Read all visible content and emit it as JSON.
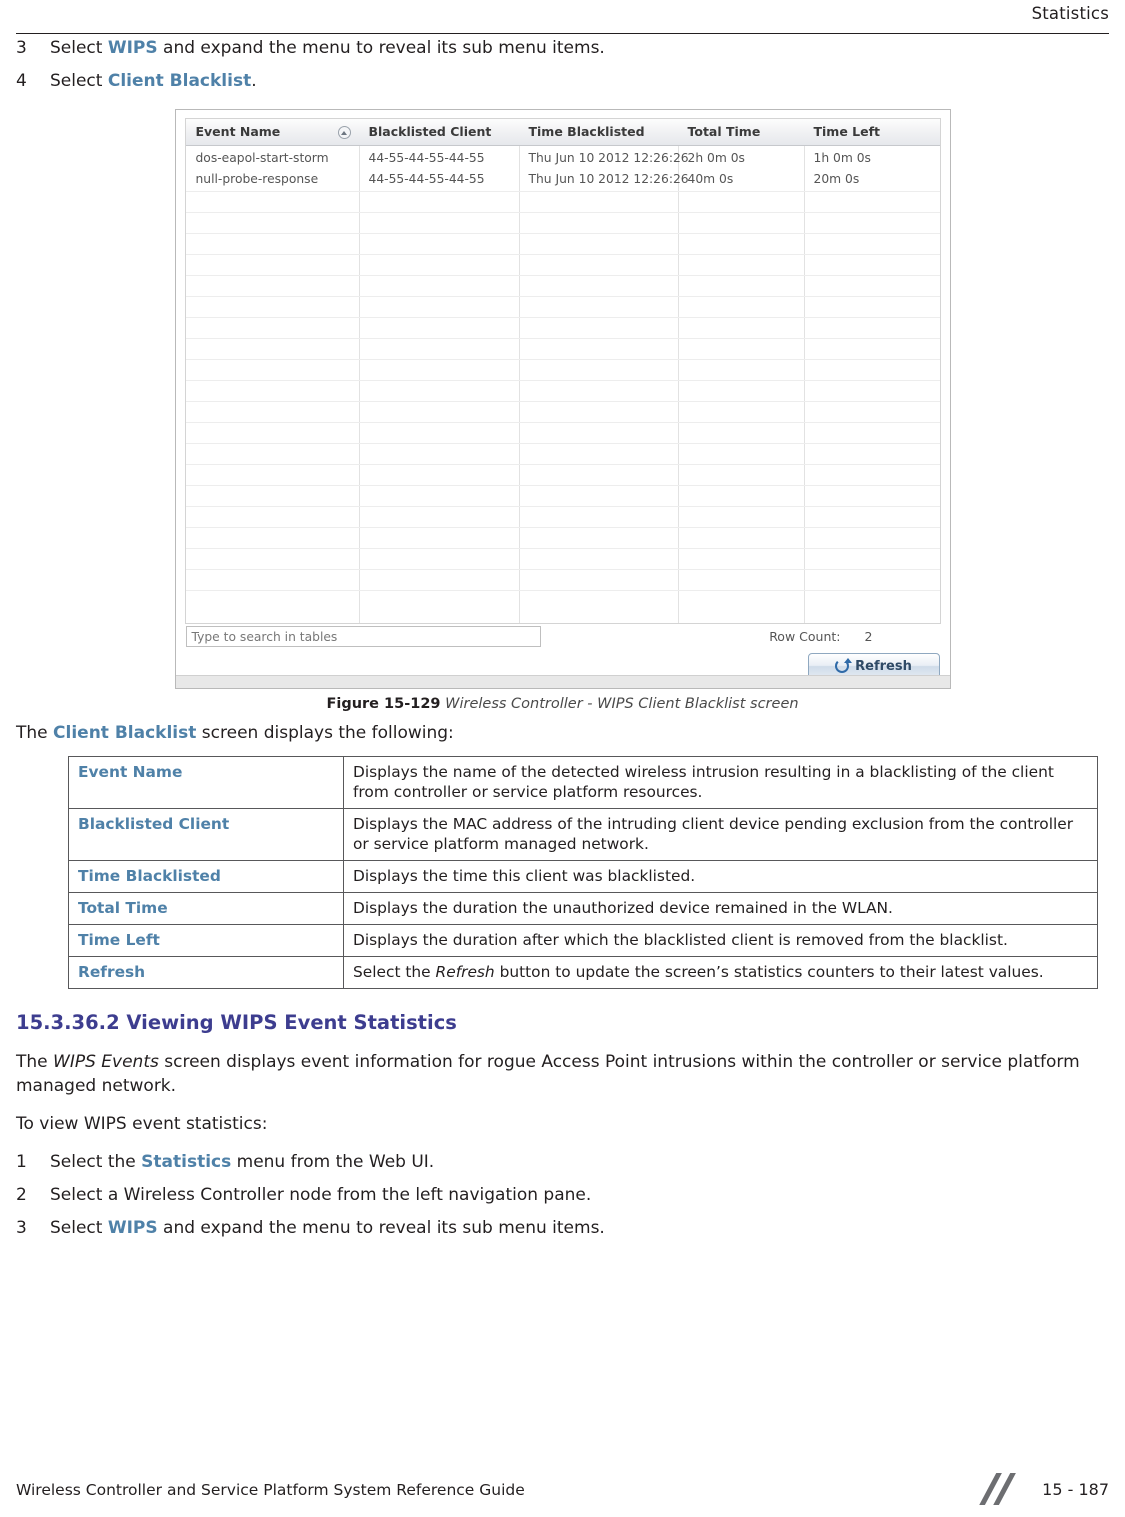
{
  "header": {
    "title": "Statistics"
  },
  "steps_top": [
    {
      "num": "3",
      "pre": "Select ",
      "link": "WIPS",
      "post": " and expand the menu to reveal its sub menu items."
    },
    {
      "num": "4",
      "pre": "Select ",
      "link": "Client Blacklist",
      "post": "."
    }
  ],
  "screenshot": {
    "columns": [
      "Event Name",
      "Blacklisted Client",
      "Time Blacklisted",
      "Total Time",
      "Time Left"
    ],
    "sort_indicator": "sort-ascending-icon",
    "rows": [
      {
        "event_name": "dos-eapol-start-storm",
        "blacklisted_client": "44-55-44-55-44-55",
        "time_blacklisted": "Thu Jun 10 2012 12:26:26",
        "total_time": "2h 0m 0s",
        "time_left": "1h 0m 0s"
      },
      {
        "event_name": "null-probe-response",
        "blacklisted_client": "44-55-44-55-44-55",
        "time_blacklisted": "Thu Jun 10 2012 12:26:26",
        "total_time": "40m 0s",
        "time_left": "20m 0s"
      }
    ],
    "search_placeholder": "Type to search in tables",
    "row_count_label": "Row Count:",
    "row_count_value": "2",
    "refresh_label": "Refresh"
  },
  "figure": {
    "number": "Figure 15-129",
    "title": "Wireless Controller - WIPS Client Blacklist screen"
  },
  "lead": {
    "pre": "The ",
    "link": "Client Blacklist",
    "post": " screen displays the following:"
  },
  "definitions": [
    {
      "term": "Event Name",
      "desc": "Displays the name of the detected wireless intrusion resulting in a blacklisting of the client from controller or service platform resources."
    },
    {
      "term": "Blacklisted Client",
      "desc": "Displays the MAC address of the intruding client device pending exclusion from the controller or service platform managed network."
    },
    {
      "term": "Time Blacklisted",
      "desc": "Displays the time this client was blacklisted."
    },
    {
      "term": "Total Time",
      "desc": "Displays the duration the unauthorized device remained in the WLAN."
    },
    {
      "term": "Time Left",
      "desc": "Displays the duration after which the blacklisted client is removed from the blacklist."
    },
    {
      "term": "Refresh",
      "desc_pre": "Select the ",
      "desc_ital": "Refresh",
      "desc_post": " button to update the screen’s statistics counters to their latest values."
    }
  ],
  "section": {
    "heading": "15.3.36.2  Viewing WIPS Event Statistics",
    "intro_pre": "The ",
    "intro_ital": "WIPS Events",
    "intro_post": " screen displays event information for rogue Access Point intrusions within the controller or service platform managed network.",
    "tolist": "To view WIPS event statistics:",
    "steps": [
      {
        "num": "1",
        "pre": "Select the ",
        "link": "Statistics",
        "post": " menu from the Web UI."
      },
      {
        "num": "2",
        "pre": "Select a Wireless Controller node from the left navigation pane.",
        "link": "",
        "post": ""
      },
      {
        "num": "3",
        "pre": "Select ",
        "link": "WIPS",
        "post": " and expand the menu to reveal its sub menu items."
      }
    ]
  },
  "footer": {
    "guide": "Wireless Controller and Service Platform System Reference Guide",
    "page": "15 - 187"
  }
}
